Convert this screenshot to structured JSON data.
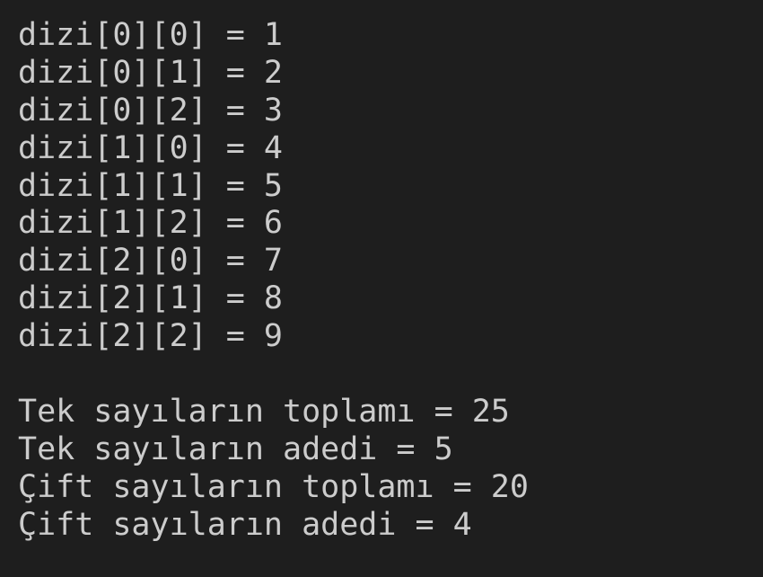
{
  "output": {
    "lines": [
      "dizi[0][0] = 1",
      "dizi[0][1] = 2",
      "dizi[0][2] = 3",
      "dizi[1][0] = 4",
      "dizi[1][1] = 5",
      "dizi[1][2] = 6",
      "dizi[2][0] = 7",
      "dizi[2][1] = 8",
      "dizi[2][2] = 9",
      "",
      "Tek sayıların toplamı = 25",
      "Tek sayıların adedi = 5",
      "Çift sayıların toplamı = 20",
      "Çift sayıların adedi = 4"
    ]
  },
  "colors": {
    "background": "#1e1e1e",
    "text": "#cccccc"
  }
}
